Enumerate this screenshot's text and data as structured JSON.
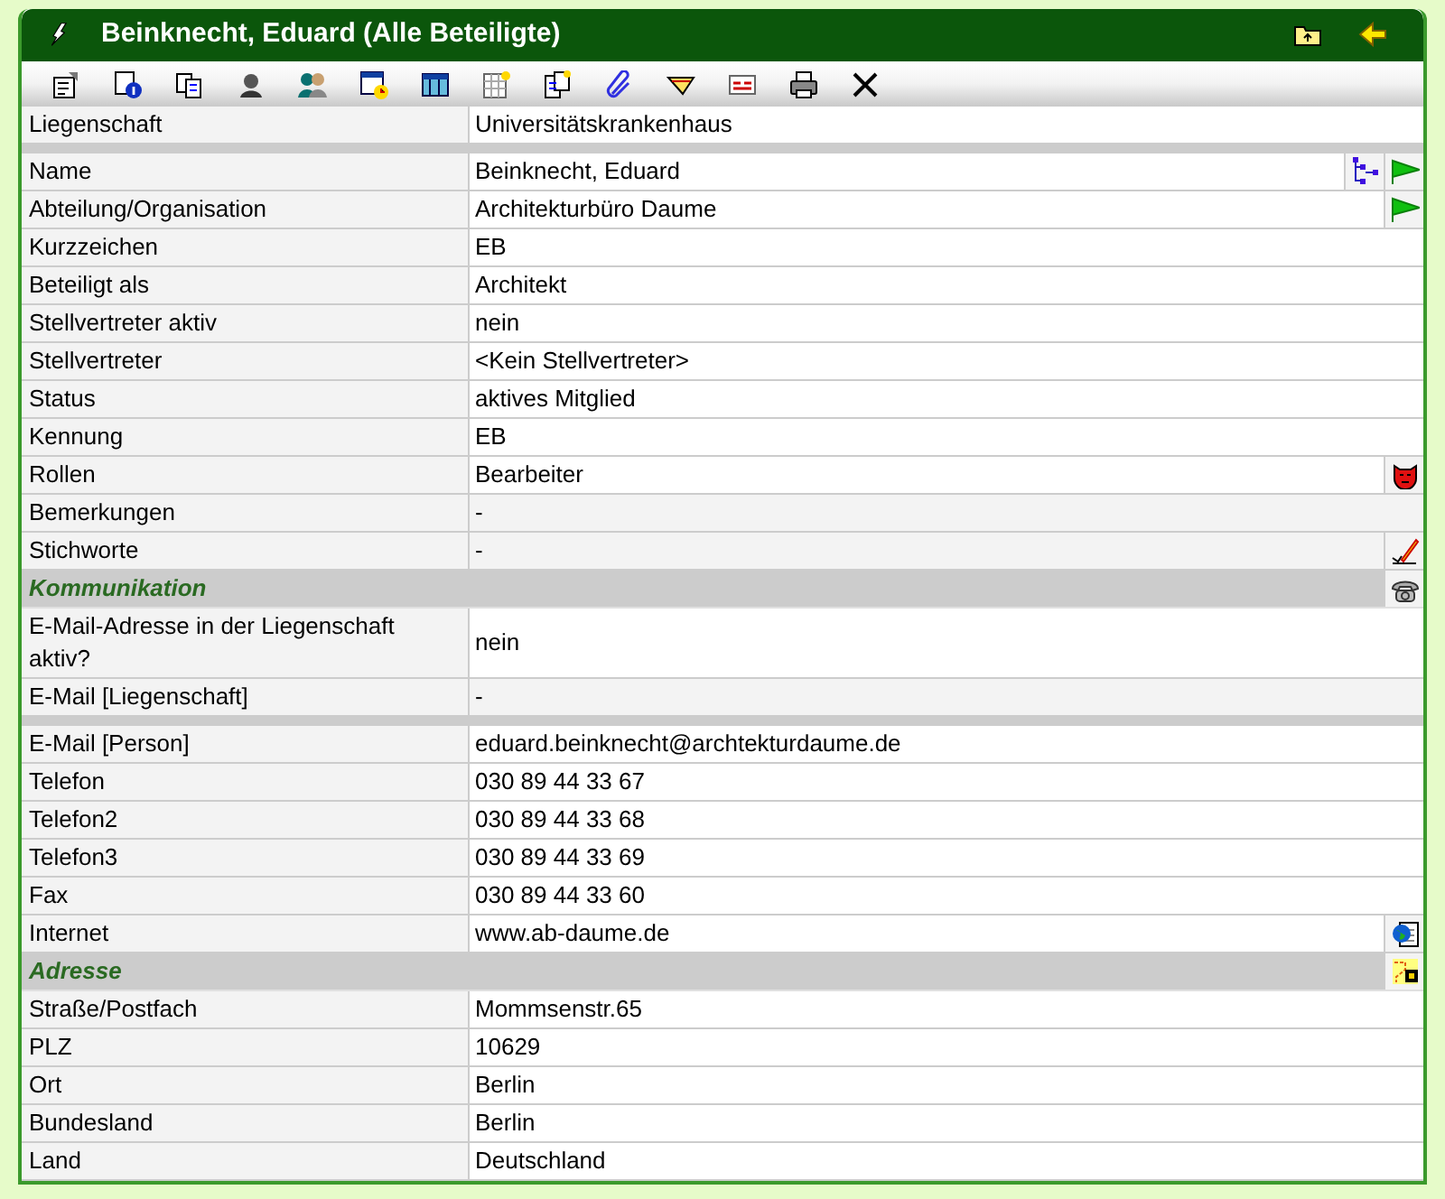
{
  "title": "Beinknecht, Eduard (Alle Beteiligte)",
  "title_icons": [
    {
      "kind": "folder-up"
    },
    {
      "kind": "back-arrow"
    }
  ],
  "toolbar": [
    {
      "kind": "properties"
    },
    {
      "kind": "info"
    },
    {
      "kind": "copy"
    },
    {
      "kind": "person"
    },
    {
      "kind": "persons"
    },
    {
      "kind": "calendar"
    },
    {
      "kind": "table"
    },
    {
      "kind": "new-grid"
    },
    {
      "kind": "new-doc"
    },
    {
      "kind": "link"
    },
    {
      "kind": "tag"
    },
    {
      "kind": "form"
    },
    {
      "kind": "print"
    },
    {
      "kind": "close"
    }
  ],
  "rows": [
    {
      "kind": "field",
      "label": "Liegenschaft",
      "value": "Universitätskrankenhaus",
      "shaded": false,
      "actions": []
    },
    {
      "kind": "separator"
    },
    {
      "kind": "field",
      "label": "Name",
      "value": "Beinknecht, Eduard",
      "shaded": false,
      "actions": [
        {
          "kind": "tree"
        },
        {
          "kind": "flag"
        }
      ]
    },
    {
      "kind": "field",
      "label": "Abteilung/Organisation",
      "value": "Architekturbüro Daume",
      "shaded": false,
      "actions": [
        {
          "kind": "flag"
        }
      ]
    },
    {
      "kind": "field",
      "label": "Kurzzeichen",
      "value": "EB",
      "shaded": false,
      "actions": []
    },
    {
      "kind": "field",
      "label": "Beteiligt als",
      "value": "Architekt",
      "shaded": false,
      "actions": []
    },
    {
      "kind": "field",
      "label": "Stellvertreter aktiv",
      "value": "nein",
      "shaded": false,
      "actions": []
    },
    {
      "kind": "field",
      "label": "Stellvertreter",
      "value": "<Kein Stellvertreter>",
      "shaded": false,
      "actions": []
    },
    {
      "kind": "field",
      "label": "Status",
      "value": "aktives Mitglied",
      "shaded": false,
      "actions": []
    },
    {
      "kind": "field",
      "label": "Kennung",
      "value": "EB",
      "shaded": false,
      "actions": []
    },
    {
      "kind": "field",
      "label": "Rollen",
      "value": "Bearbeiter",
      "shaded": false,
      "actions": [
        {
          "kind": "mask"
        }
      ]
    },
    {
      "kind": "field",
      "label": "Bemerkungen",
      "value": "-",
      "shaded": true,
      "actions": []
    },
    {
      "kind": "field",
      "label": "Stichworte",
      "value": "-",
      "shaded": true,
      "actions": [
        {
          "kind": "pen"
        }
      ]
    },
    {
      "kind": "section",
      "label": "Kommunikation",
      "actions": [
        {
          "kind": "phone"
        }
      ]
    },
    {
      "kind": "field",
      "label": "E-Mail-Adresse in der Liegenschaft aktiv?",
      "value": "nein",
      "shaded": false,
      "actions": []
    },
    {
      "kind": "field",
      "label": "E-Mail [Liegenschaft]",
      "value": "-",
      "shaded": true,
      "actions": []
    },
    {
      "kind": "separator"
    },
    {
      "kind": "field",
      "label": "E-Mail [Person]",
      "value": "eduard.beinknecht@archtekturdaume.de",
      "shaded": false,
      "actions": []
    },
    {
      "kind": "field",
      "label": "Telefon",
      "value": "030 89 44 33 67",
      "shaded": false,
      "actions": []
    },
    {
      "kind": "field",
      "label": "Telefon2",
      "value": "030 89 44 33 68",
      "shaded": false,
      "actions": []
    },
    {
      "kind": "field",
      "label": "Telefon3",
      "value": "030 89 44 33 69",
      "shaded": false,
      "actions": []
    },
    {
      "kind": "field",
      "label": "Fax",
      "value": "030 89 44 33 60",
      "shaded": false,
      "actions": []
    },
    {
      "kind": "field",
      "label": "Internet",
      "value": "www.ab-daume.de",
      "shaded": false,
      "actions": [
        {
          "kind": "web-page"
        }
      ]
    },
    {
      "kind": "section",
      "label": "Adresse",
      "actions": [
        {
          "kind": "address"
        }
      ]
    },
    {
      "kind": "field",
      "label": "Straße/Postfach",
      "value": "Mommsenstr.65",
      "shaded": false,
      "actions": []
    },
    {
      "kind": "field",
      "label": "PLZ",
      "value": "10629",
      "shaded": false,
      "actions": []
    },
    {
      "kind": "field",
      "label": "Ort",
      "value": "Berlin",
      "shaded": false,
      "actions": []
    },
    {
      "kind": "field",
      "label": "Bundesland",
      "value": "Berlin",
      "shaded": false,
      "actions": []
    },
    {
      "kind": "field",
      "label": "Land",
      "value": "Deutschland",
      "shaded": false,
      "actions": []
    }
  ]
}
